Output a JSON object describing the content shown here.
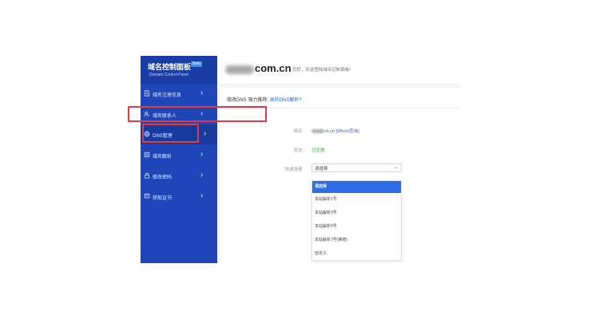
{
  "brand": {
    "title": "域名控制面板",
    "badge": "Beta",
    "subtitle": "Domain Control Panel"
  },
  "sidebar": {
    "items": [
      {
        "label": "域名注册信息",
        "icon": "document-icon",
        "chevron": "›"
      },
      {
        "label": "域名联系人",
        "icon": "person-icon",
        "chevron": "›"
      },
      {
        "label": "DNS管理",
        "icon": "globe-icon",
        "chevron": "›",
        "active": true
      },
      {
        "label": "域名解析",
        "icon": "grid-icon",
        "chevron": "›"
      },
      {
        "label": "修改密码",
        "icon": "lock-icon",
        "chevron": "›"
      },
      {
        "label": "获取证书",
        "icon": "certificate-icon",
        "chevron": "›"
      }
    ]
  },
  "header": {
    "domain_suffix": "com.cn",
    "welcome": "您好，欢迎登陆域名控制面板!"
  },
  "breadcrumb": {
    "current": "修改DNS",
    "recommend": "强力推荐:",
    "link": "高防DNS解析?"
  },
  "form": {
    "domain_label": "域名:",
    "domain_value": "m.cn",
    "whois_link": "[Whois查询]",
    "status_label": "状态:",
    "status_value": "已生效",
    "quick_label": "快速选择:",
    "select_value": "请选择",
    "select_caret": "⌄"
  },
  "dropdown": {
    "options": [
      "请选择",
      "本站解析1号",
      "本站解析3号",
      "本站解析5号",
      "本站解析7号(推荐)",
      "自定义"
    ],
    "selected_index": 0
  },
  "colors": {
    "sidebar": "#1f46b8",
    "accent": "#2e6be6",
    "highlight": "#e53a3a",
    "link": "#2f6fd6",
    "success": "#2aa63a"
  }
}
